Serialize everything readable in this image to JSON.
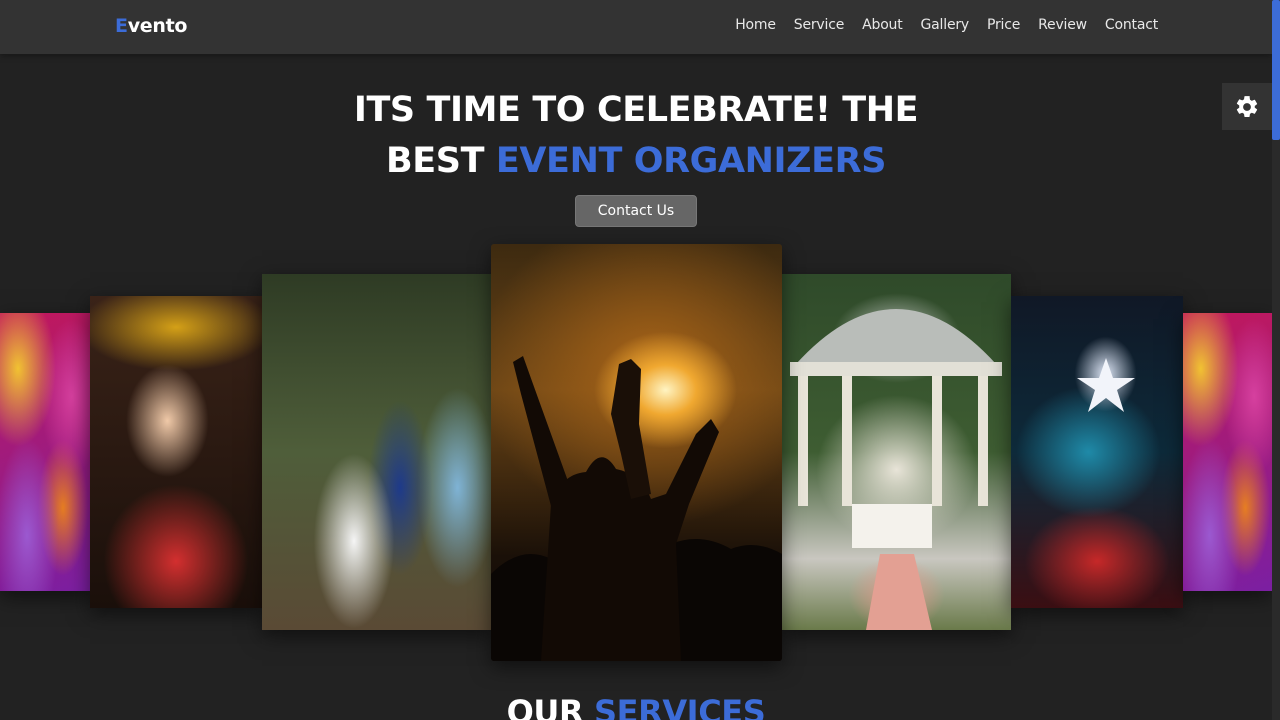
{
  "brand": {
    "first_letter": "E",
    "rest": "vento"
  },
  "nav": {
    "items": [
      {
        "label": "Home"
      },
      {
        "label": "Service"
      },
      {
        "label": "About"
      },
      {
        "label": "Gallery"
      },
      {
        "label": "Price"
      },
      {
        "label": "Review"
      },
      {
        "label": "Contact"
      }
    ]
  },
  "hero": {
    "line1": "ITS TIME TO CELEBRATE! THE",
    "line2_plain": "BEST ",
    "line2_accent": "EVENT ORGANIZERS",
    "cta_label": "Contact Us"
  },
  "settings": {
    "icon": "gear-icon"
  },
  "gallery": {
    "images": [
      {
        "subject": "holi-festival"
      },
      {
        "subject": "birthday-party"
      },
      {
        "subject": "wedding"
      },
      {
        "subject": "concert"
      },
      {
        "subject": "garden-wedding-gazebo"
      },
      {
        "subject": "nightclub-dj"
      },
      {
        "subject": "holi-festival"
      }
    ]
  },
  "services": {
    "title_plain": "OUR ",
    "title_accent": "SERVICES"
  },
  "colors": {
    "accent": "#3c6cd8",
    "header_bg": "#333333",
    "page_bg": "#222222",
    "button_bg": "#666666"
  }
}
